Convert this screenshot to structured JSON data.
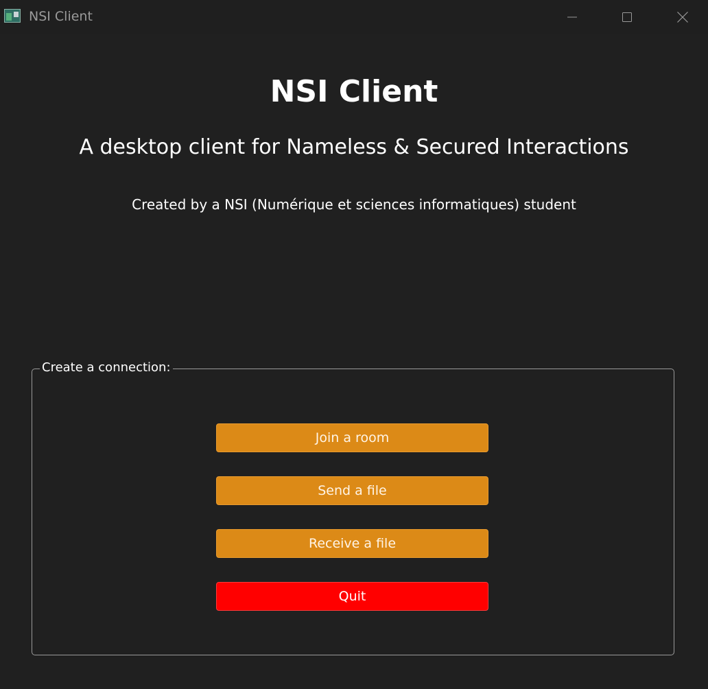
{
  "window": {
    "title": "NSI Client",
    "controls": {
      "minimize_icon": "minimize-icon",
      "maximize_icon": "maximize-icon",
      "close_icon": "close-icon"
    }
  },
  "main": {
    "heading": "NSI Client",
    "subheading": "A desktop client for Nameless & Secured Interactions",
    "credit": "Created by a NSI (Numérique et sciences informatiques) student"
  },
  "connection_group": {
    "legend": "Create a connection:",
    "buttons": [
      {
        "label": "Join a room",
        "color": "#dc8a17"
      },
      {
        "label": "Send a file",
        "color": "#dc8a17"
      },
      {
        "label": "Receive a file",
        "color": "#dc8a17"
      },
      {
        "label": "Quit",
        "color": "#ff0000"
      }
    ]
  },
  "colors": {
    "background": "#202020",
    "accent": "#dc8a17",
    "danger": "#ff0000"
  }
}
